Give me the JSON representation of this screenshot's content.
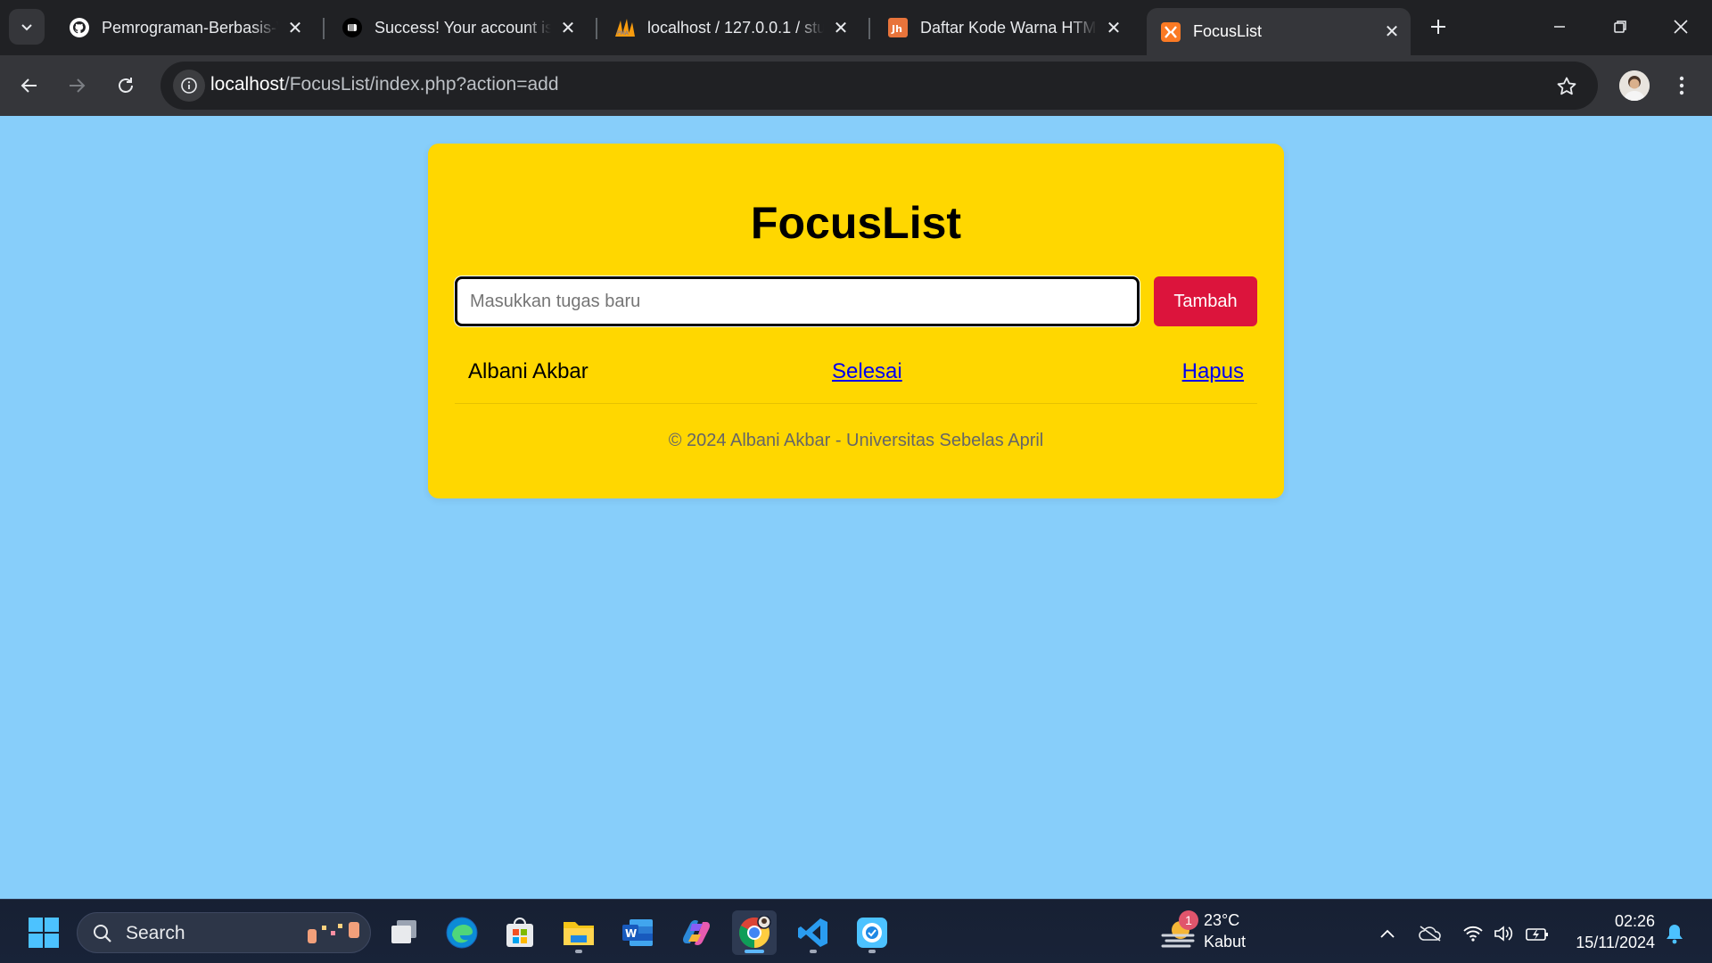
{
  "browser": {
    "tabs": [
      {
        "title": "Pemrograman-Berbasis-W",
        "icon": "github-icon"
      },
      {
        "title": "Success! Your account is c",
        "icon": "fist-icon"
      },
      {
        "title": "localhost / 127.0.0.1 / stu",
        "icon": "phpmyadmin-icon"
      },
      {
        "title": "Daftar Kode Warna HTML",
        "icon": "jh-icon"
      },
      {
        "title": "FocusList",
        "icon": "xampp-icon",
        "active": true
      }
    ],
    "url_host": "localhost",
    "url_path": "/FocusList/index.php?action=add"
  },
  "app": {
    "title": "FocusList",
    "input_placeholder": "Masukkan tugas baru",
    "add_button": "Tambah",
    "tasks": [
      {
        "name": "Albani Akbar",
        "done_label": "Selesai",
        "delete_label": "Hapus"
      }
    ],
    "footer": "© 2024 Albani Akbar - Universitas Sebelas April",
    "colors": {
      "page_bg": "#87CEFA",
      "card_bg": "#FFD700",
      "button_bg": "#DC143C"
    }
  },
  "taskbar": {
    "search_label": "Search",
    "weather": {
      "temp": "23°C",
      "desc": "Kabut",
      "badge": "1"
    },
    "time": "02:26",
    "date": "15/11/2024"
  }
}
